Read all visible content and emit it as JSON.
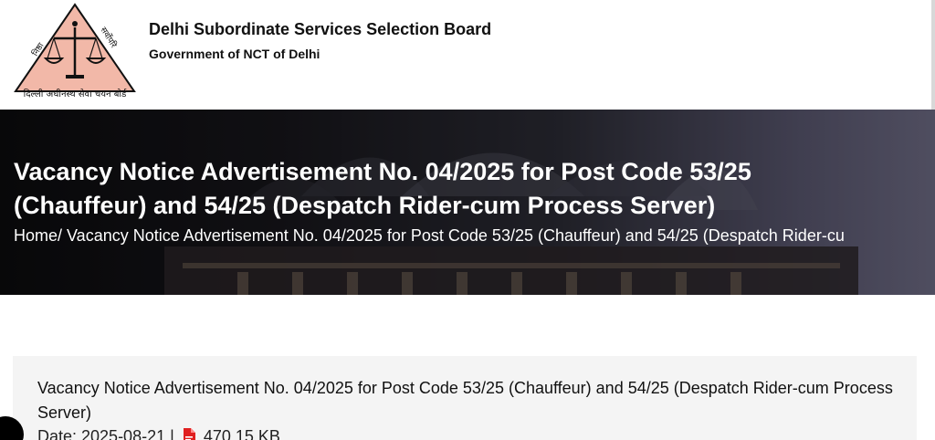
{
  "header": {
    "org_name": "Delhi Subordinate Services Selection Board",
    "org_sub": "Government of NCT of Delhi",
    "logo_text": "दिल्ली अधीनस्थ सेवा चयन बोर्ड",
    "logo_left": "निष्ठा",
    "logo_right": "सर्वोपरि"
  },
  "banner": {
    "title": "Vacancy Notice Advertisement No. 04/2025 for Post Code 53/25 (Chauffeur) and 54/25 (Despatch Rider-cum Process Server)",
    "breadcrumb": "Home/ Vacancy Notice Advertisement No. 04/2025 for Post Code 53/25 (Chauffeur) and 54/25 (Despatch Rider-cu"
  },
  "notice": {
    "title": "Vacancy Notice Advertisement No. 04/2025 for Post Code 53/25 (Chauffeur) and 54/25 (Despatch Rider-cum Process Server)",
    "date_label": "Date: 2025-08-21 |",
    "file_size": "470.15 KB"
  },
  "icons": {
    "pdf": "pdf-file-icon",
    "logo": "dsssb-emblem-icon"
  },
  "colors": {
    "logo_fill": "#f2b8a8",
    "pdf_red": "#e02020",
    "card_bg": "#f4f4f4"
  }
}
